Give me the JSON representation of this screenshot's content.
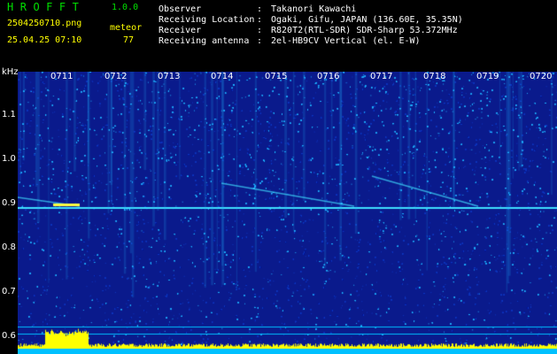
{
  "app": {
    "name": "HROFFT",
    "version": "1.0.0"
  },
  "info": {
    "file_name": "2504250710.png",
    "datetime": "25.04.25 07:10",
    "mode_label": "meteor",
    "count": "77"
  },
  "metadata": [
    {
      "key": "Observer",
      "value": "Takanori Kawachi"
    },
    {
      "key": "Receiving Location",
      "value": "Ogaki, Gifu, JAPAN (136.60E, 35.35N)"
    },
    {
      "key": "Receiver",
      "value": "R820T2(RTL-SDR) SDR-Sharp 53.372MHz"
    },
    {
      "key": "Receiving antenna",
      "value": "2el-HB9CV Vertical (el. E-W)"
    }
  ],
  "separator": ":",
  "spectrogram": {
    "unit": "kHz",
    "frequency_labels": [
      "1.1",
      "1.0",
      "0.9",
      "0.8",
      "0.7",
      "0.6"
    ],
    "time_labels": [
      "0711",
      "0712",
      "0713",
      "0714",
      "0715",
      "0716",
      "0717",
      "0718",
      "0719",
      "0720"
    ],
    "colors": {
      "background": "#0a1a8c",
      "noise_low": "#1038c0",
      "noise_high": "#20b0ff",
      "carrier": "#40e0ff",
      "echo": "#ffff40",
      "power_bar": "#ffff00",
      "baseline": "#00c0ff"
    }
  }
}
